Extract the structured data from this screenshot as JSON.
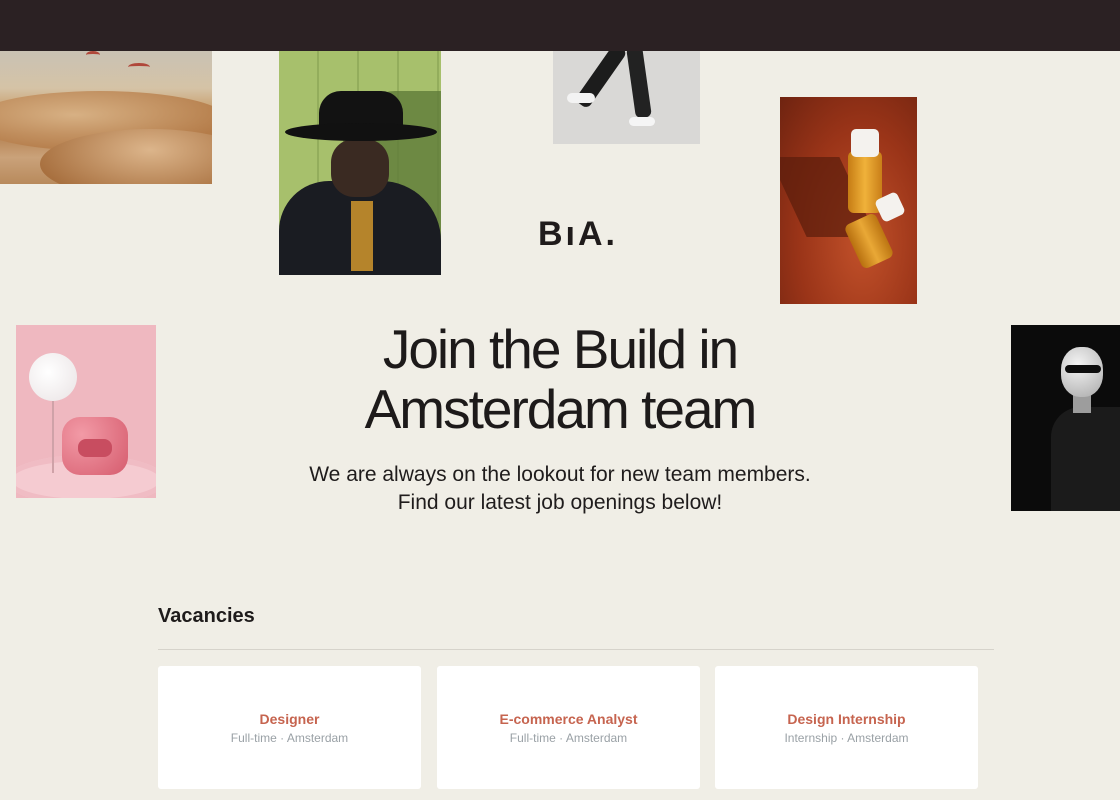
{
  "brand": {
    "logo_text": "BıA."
  },
  "hero": {
    "title_line1": "Join the Build in",
    "title_line2": "Amsterdam team",
    "subtitle_line1": "We are always on the lookout for new team members.",
    "subtitle_line2": "Find our latest job openings below!"
  },
  "vacancies": {
    "heading": "Vacancies",
    "items": [
      {
        "title": "Designer",
        "type": "Full-time",
        "separator": "·",
        "location": "Amsterdam"
      },
      {
        "title": "E-commerce Analyst",
        "type": "Full-time",
        "separator": "·",
        "location": "Amsterdam"
      },
      {
        "title": "Design Internship",
        "type": "Internship",
        "separator": "·",
        "location": "Amsterdam"
      }
    ]
  },
  "colors": {
    "page_background": "#f0eee6",
    "top_bar": "#2b2123",
    "accent_job_title": "#c6644f",
    "meta_text": "#9aa1a6",
    "heading_text": "#1d1a1a"
  }
}
